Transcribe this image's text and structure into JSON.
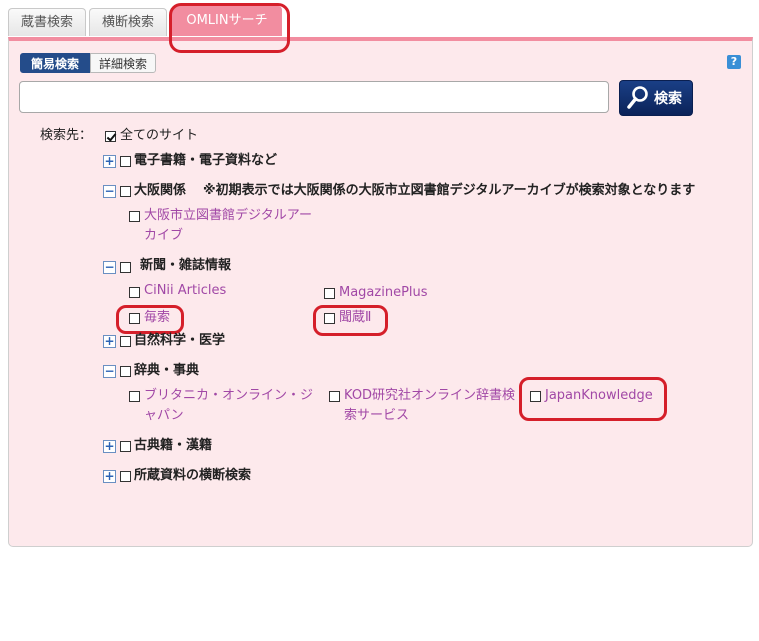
{
  "tabs": [
    {
      "label": "蔵書検索"
    },
    {
      "label": "横断検索"
    },
    {
      "label": "OMLINサーチ"
    }
  ],
  "mode": {
    "simple": "簡易検索",
    "advanced": "詳細検索"
  },
  "help_label": "?",
  "search": {
    "value": "",
    "placeholder": "",
    "button_label": "検索"
  },
  "targets": {
    "label": "検索先：",
    "all_sites": "全てのサイト",
    "groups": {
      "ebooks": {
        "label": "電子書籍・電子資料など"
      },
      "osaka": {
        "label": "大阪関係",
        "note": "※初期表示では大阪関係の大阪市立図書館デジタルアーカイブが検索対象となります",
        "items": [
          {
            "label_line1": "大阪市立図書館デジタルアー",
            "label_line2": "カイブ"
          }
        ]
      },
      "news": {
        "label": "新聞・雑誌情報",
        "items": [
          {
            "label": "CiNii Articles"
          },
          {
            "label": "MagazinePlus"
          },
          {
            "label": "毎索"
          },
          {
            "label": "聞蔵Ⅱ"
          }
        ]
      },
      "science": {
        "label": "自然科学・医学"
      },
      "dictionary": {
        "label": "辞典・事典",
        "items": [
          {
            "label_line1": "ブリタニカ・オンライン・ジ",
            "label_line2": "ャパン"
          },
          {
            "label_line1": "KOD研究社オンライン辞書検",
            "label_line2": "索サービス"
          },
          {
            "label": "JapanKnowledge"
          }
        ]
      },
      "classics": {
        "label": "古典籍・漢籍"
      },
      "holdings": {
        "label": "所蔵資料の横断検索"
      }
    }
  }
}
